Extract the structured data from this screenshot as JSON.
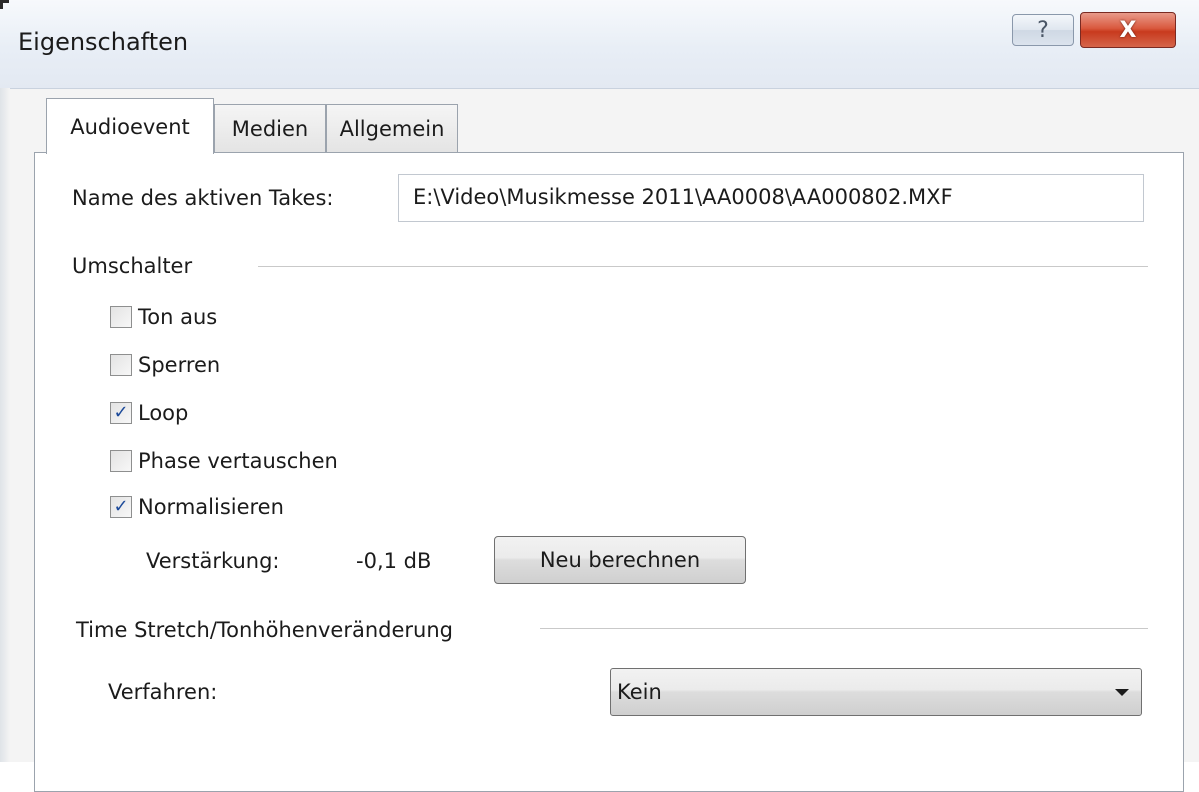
{
  "window": {
    "title": "Eigenschaften",
    "help_glyph": "?",
    "close_glyph": "X"
  },
  "tabs": [
    {
      "label": "Audioevent",
      "active": true
    },
    {
      "label": "Medien",
      "active": false
    },
    {
      "label": "Allgemein",
      "active": false
    }
  ],
  "take": {
    "label": "Name des aktiven Takes:",
    "value": "E:\\Video\\Musikmesse 2011\\AA0008\\AA000802.MXF"
  },
  "switches": {
    "group_label": "Umschalter",
    "items": [
      {
        "label": "Ton aus",
        "checked": false
      },
      {
        "label": "Sperren",
        "checked": false
      },
      {
        "label": "Loop",
        "checked": true
      },
      {
        "label": "Phase vertauschen",
        "checked": false
      },
      {
        "label": "Normalisieren",
        "checked": true
      }
    ],
    "check_glyph": "✓"
  },
  "gain": {
    "label": "Verstärkung:",
    "value": "-0,1 dB",
    "recalc_button": "Neu berechnen"
  },
  "timestretch": {
    "group_label": "Time Stretch/Tonhöhenveränderung",
    "method_label": "Verfahren:",
    "method_value": "Kein"
  }
}
